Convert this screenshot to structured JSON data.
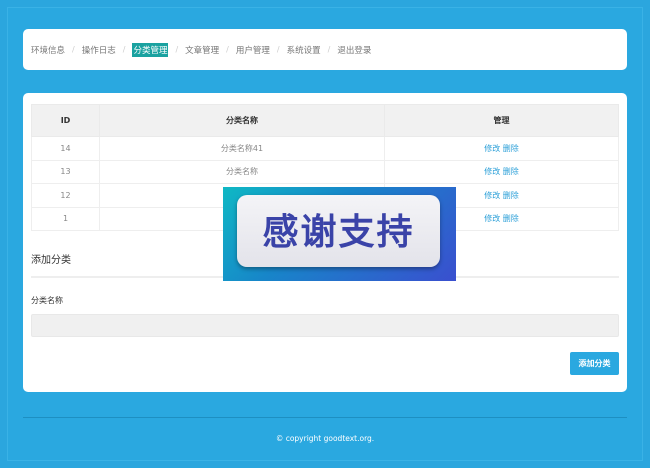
{
  "nav": {
    "items": [
      "环境信息",
      "操作日志",
      "分类管理",
      "文章管理",
      "用户管理",
      "系统设置",
      "退出登录"
    ],
    "separator": "/"
  },
  "table": {
    "headers": [
      "ID",
      "分类名称",
      "管理"
    ],
    "rows": [
      {
        "id": "14",
        "name": "分类名称41",
        "edit": "修改",
        "delete": "删除"
      },
      {
        "id": "13",
        "name": "分类名称",
        "edit": "修改",
        "delete": "删除"
      },
      {
        "id": "12",
        "name": "",
        "edit": "修改",
        "delete": "删除"
      },
      {
        "id": "1",
        "name": "",
        "edit": "修改",
        "delete": "删除"
      }
    ]
  },
  "form": {
    "section_title": "添加分类",
    "field_label": "分类名称",
    "field_value": "",
    "submit_label": "添加分类"
  },
  "overlay": {
    "text": "感谢支持"
  },
  "footer": {
    "copyright": "© copyright goodtext.org."
  },
  "colors": {
    "background": "#2ba6de",
    "active_nav": "#1aa2a0",
    "link": "#2a9fd8",
    "button": "#2aa8e0"
  }
}
